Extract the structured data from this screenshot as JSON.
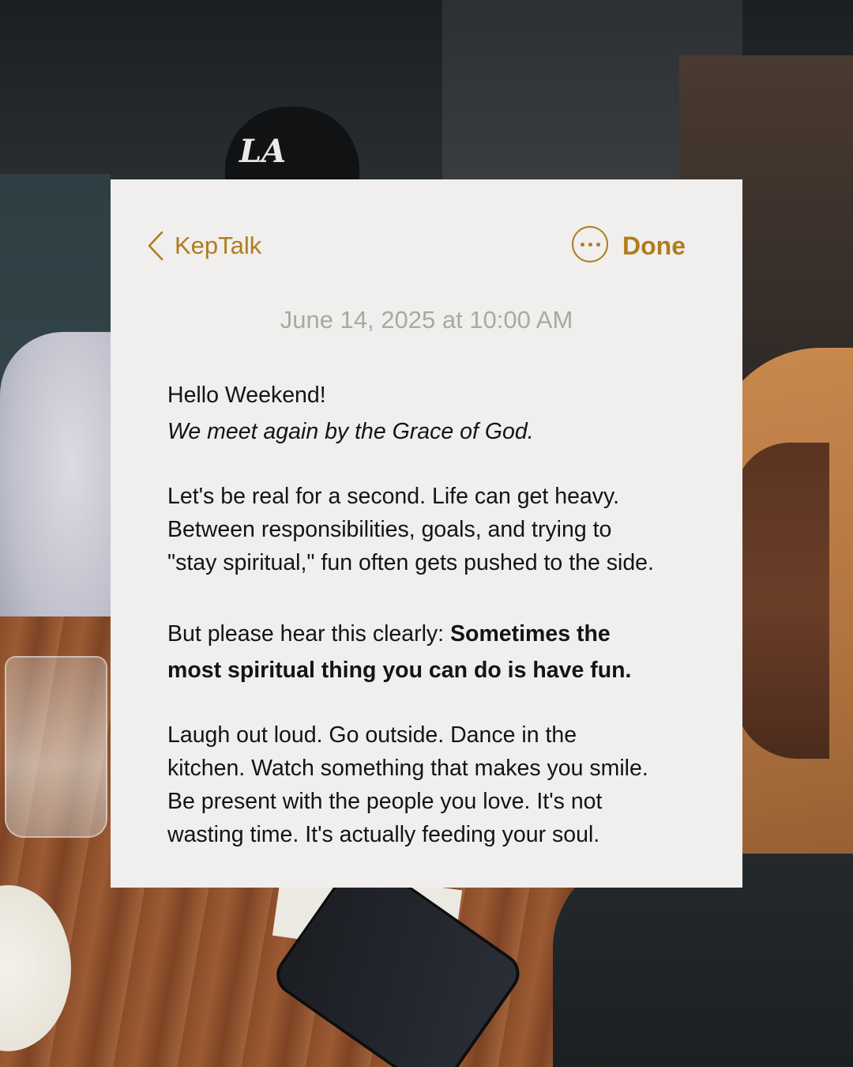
{
  "note": {
    "back_label": "KepTalk",
    "done_label": "Done",
    "timestamp": "June 14, 2025 at 10:00 AM",
    "greeting": "Hello Weekend!",
    "subgreeting": "We meet again by the Grace of God.",
    "paragraph1_lines": [
      "Let's be real for a second. Life can get heavy.",
      "Between responsibilities, goals, and trying to",
      "\"stay spiritual,\" fun often gets pushed to the side."
    ],
    "paragraph2_lead": "But please hear this clearly: ",
    "paragraph2_bold_start": "Sometimes the",
    "paragraph2_bold_end": "most spiritual thing you can do is have fun.",
    "paragraph3_lines": [
      "Laugh out loud. Go outside. Dance in the",
      "kitchen. Watch something that makes you smile.",
      "Be present with the people you love. It's not",
      "wasting time. It's actually feeding your soul."
    ]
  },
  "background": {
    "cap_logo": "LA"
  },
  "colors": {
    "accent": "#b07d1e",
    "card_background": "#f0efed",
    "timestamp_gray": "#a9a8a5",
    "text": "#141414"
  },
  "icons": {
    "back": "chevron-left-icon",
    "more": "ellipsis-circle-icon"
  }
}
